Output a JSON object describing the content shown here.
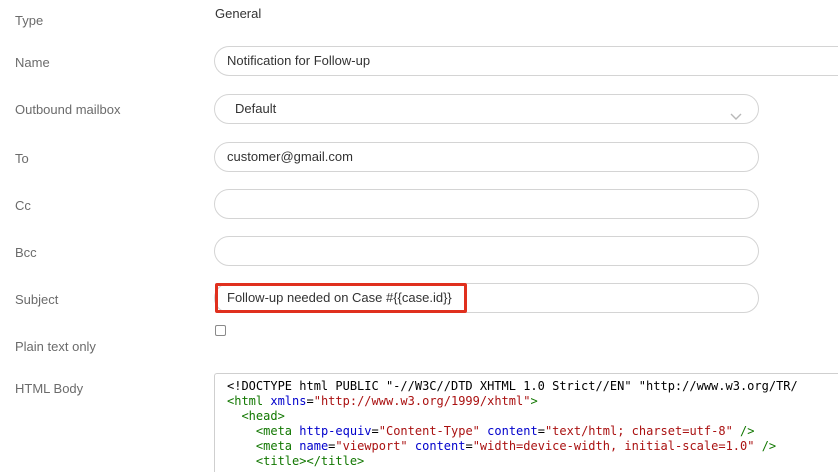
{
  "form": {
    "type": {
      "label": "Type",
      "value": "General"
    },
    "name": {
      "label": "Name",
      "value": "Notification for Follow-up"
    },
    "outbound_mailbox": {
      "label": "Outbound mailbox",
      "value": "Default",
      "icon": "chevron-down-icon"
    },
    "to": {
      "label": "To",
      "value": "customer@gmail.com"
    },
    "cc": {
      "label": "Cc",
      "value": ""
    },
    "bcc": {
      "label": "Bcc",
      "value": ""
    },
    "subject": {
      "label": "Subject",
      "value": "Follow-up needed on Case #{{case.id}}",
      "highlight_color": "#e0301e"
    },
    "plain_text_only": {
      "label": "Plain text only",
      "checked": false
    },
    "html_body": {
      "label": "HTML Body",
      "lines": [
        {
          "indent": "",
          "parts": [
            {
              "t": "txt",
              "v": "<!DOCTYPE html PUBLIC \"-//W3C//DTD XHTML 1.0 Strict//EN\" \"http://www.w3.org/TR/"
            }
          ]
        },
        {
          "indent": "",
          "parts": [
            {
              "t": "tag",
              "v": "<html"
            },
            {
              "t": "txt",
              "v": " "
            },
            {
              "t": "attr",
              "v": "xmlns"
            },
            {
              "t": "txt",
              "v": "="
            },
            {
              "t": "str",
              "v": "\"http://www.w3.org/1999/xhtml\""
            },
            {
              "t": "tag",
              "v": ">"
            }
          ]
        },
        {
          "indent": "  ",
          "parts": [
            {
              "t": "tag",
              "v": "<head>"
            }
          ]
        },
        {
          "indent": "    ",
          "parts": [
            {
              "t": "tag",
              "v": "<meta"
            },
            {
              "t": "txt",
              "v": " "
            },
            {
              "t": "attr",
              "v": "http-equiv"
            },
            {
              "t": "txt",
              "v": "="
            },
            {
              "t": "str",
              "v": "\"Content-Type\""
            },
            {
              "t": "txt",
              "v": " "
            },
            {
              "t": "attr",
              "v": "content"
            },
            {
              "t": "txt",
              "v": "="
            },
            {
              "t": "str",
              "v": "\"text/html; charset=utf-8\""
            },
            {
              "t": "txt",
              "v": " "
            },
            {
              "t": "tag",
              "v": "/>"
            }
          ]
        },
        {
          "indent": "    ",
          "parts": [
            {
              "t": "tag",
              "v": "<meta"
            },
            {
              "t": "txt",
              "v": " "
            },
            {
              "t": "attr",
              "v": "name"
            },
            {
              "t": "txt",
              "v": "="
            },
            {
              "t": "str",
              "v": "\"viewport\""
            },
            {
              "t": "txt",
              "v": " "
            },
            {
              "t": "attr",
              "v": "content"
            },
            {
              "t": "txt",
              "v": "="
            },
            {
              "t": "str",
              "v": "\"width=device-width, initial-scale=1.0\""
            },
            {
              "t": "txt",
              "v": " "
            },
            {
              "t": "tag",
              "v": "/>"
            }
          ]
        },
        {
          "indent": "    ",
          "parts": [
            {
              "t": "tag",
              "v": "<title></title>"
            }
          ]
        }
      ]
    }
  }
}
